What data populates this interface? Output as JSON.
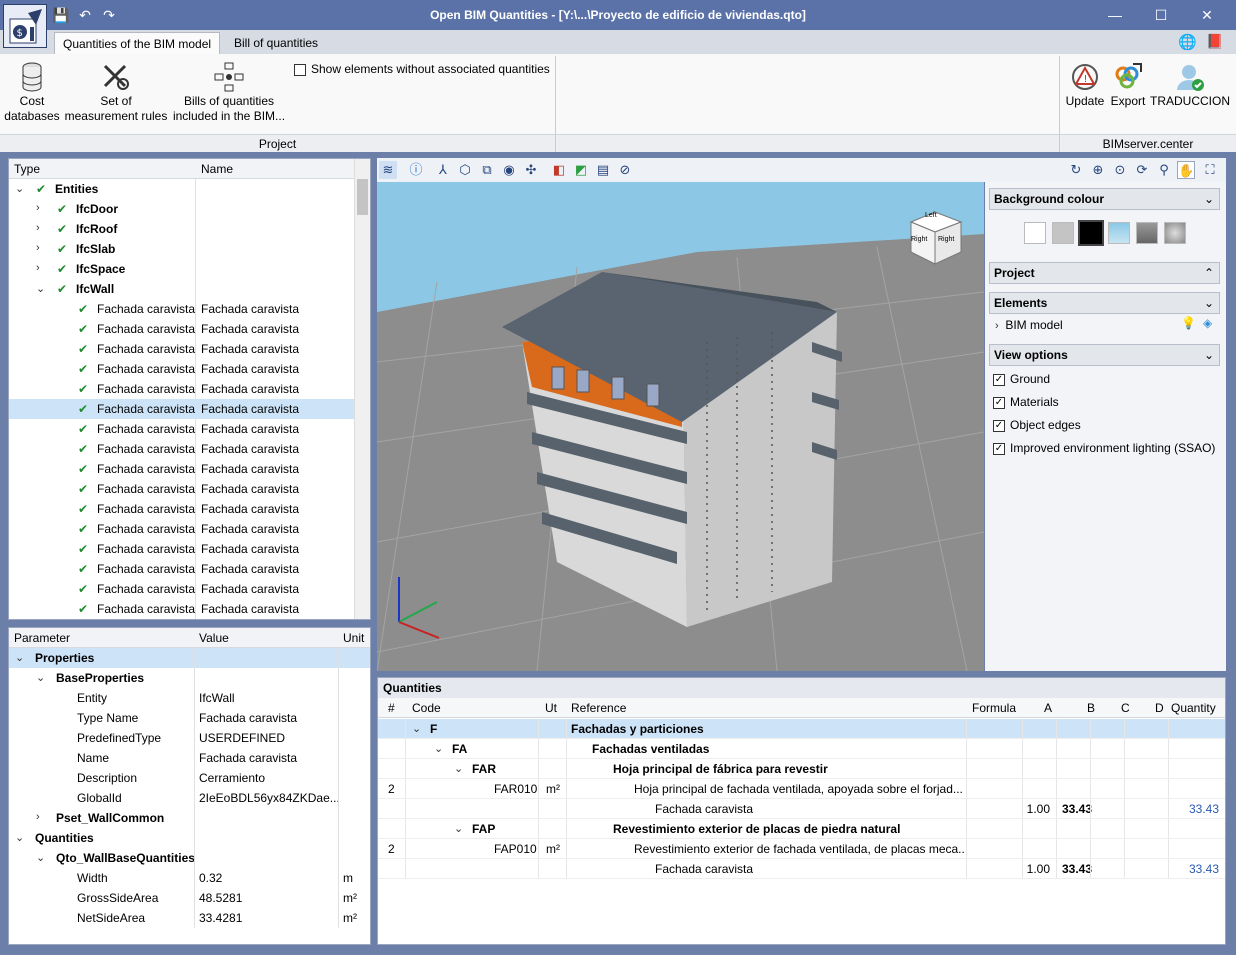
{
  "window": {
    "title": "Open BIM Quantities - [Y:\\...\\Proyecto de edificio de viviendas.qto]",
    "min": "—",
    "max": "☐",
    "close": "✕"
  },
  "tabs": [
    "Quantities of the BIM model",
    "Bill of quantities"
  ],
  "ribbon": {
    "cost_databases": "Cost\ndatabases",
    "measurement_rules": "Set of\nmeasurement rules",
    "bills_included": "Bills of quantities\nincluded in the BIM...",
    "show_elements": "Show elements without associated quantities",
    "group_project": "Project",
    "update": "Update",
    "export": "Export",
    "traduccion": "TRADUCCION",
    "group_bim": "BIMserver.center"
  },
  "tree": {
    "headers": {
      "type": "Type",
      "name": "Name"
    },
    "rows": [
      {
        "t": "Entities",
        "n": "",
        "lvl": 0,
        "exp": "⌄",
        "b": true
      },
      {
        "t": "IfcDoor",
        "n": "",
        "lvl": 1,
        "exp": "›",
        "b": true
      },
      {
        "t": "IfcRoof",
        "n": "",
        "lvl": 1,
        "exp": "›",
        "b": true
      },
      {
        "t": "IfcSlab",
        "n": "",
        "lvl": 1,
        "exp": "›",
        "b": true
      },
      {
        "t": "IfcSpace",
        "n": "",
        "lvl": 1,
        "exp": "›",
        "b": true
      },
      {
        "t": "IfcWall",
        "n": "",
        "lvl": 1,
        "exp": "⌄",
        "b": true
      },
      {
        "t": "Fachada caravista",
        "n": "Fachada caravista",
        "lvl": 2
      },
      {
        "t": "Fachada caravista",
        "n": "Fachada caravista",
        "lvl": 2
      },
      {
        "t": "Fachada caravista",
        "n": "Fachada caravista",
        "lvl": 2
      },
      {
        "t": "Fachada caravista",
        "n": "Fachada caravista",
        "lvl": 2
      },
      {
        "t": "Fachada caravista",
        "n": "Fachada caravista",
        "lvl": 2
      },
      {
        "t": "Fachada caravista",
        "n": "Fachada caravista",
        "lvl": 2,
        "sel": true
      },
      {
        "t": "Fachada caravista",
        "n": "Fachada caravista",
        "lvl": 2
      },
      {
        "t": "Fachada caravista",
        "n": "Fachada caravista",
        "lvl": 2
      },
      {
        "t": "Fachada caravista",
        "n": "Fachada caravista",
        "lvl": 2
      },
      {
        "t": "Fachada caravista",
        "n": "Fachada caravista",
        "lvl": 2
      },
      {
        "t": "Fachada caravista",
        "n": "Fachada caravista",
        "lvl": 2
      },
      {
        "t": "Fachada caravista",
        "n": "Fachada caravista",
        "lvl": 2
      },
      {
        "t": "Fachada caravista",
        "n": "Fachada caravista",
        "lvl": 2
      },
      {
        "t": "Fachada caravista",
        "n": "Fachada caravista",
        "lvl": 2
      },
      {
        "t": "Fachada caravista",
        "n": "Fachada caravista",
        "lvl": 2
      },
      {
        "t": "Fachada caravista",
        "n": "Fachada caravista",
        "lvl": 2
      }
    ]
  },
  "params": {
    "headers": {
      "param": "Parameter",
      "value": "Value",
      "unit": "Unit"
    },
    "rows": [
      {
        "p": "Properties",
        "v": "",
        "u": "",
        "lvl": 0,
        "exp": "⌄",
        "b": true,
        "sel": true
      },
      {
        "p": "BaseProperties",
        "v": "",
        "u": "",
        "lvl": 1,
        "exp": "⌄",
        "b": true
      },
      {
        "p": "Entity",
        "v": "IfcWall",
        "u": "",
        "lvl": 2
      },
      {
        "p": "Type Name",
        "v": "Fachada caravista",
        "u": "",
        "lvl": 2
      },
      {
        "p": "PredefinedType",
        "v": "USERDEFINED",
        "u": "",
        "lvl": 2
      },
      {
        "p": "Name",
        "v": "Fachada caravista",
        "u": "",
        "lvl": 2
      },
      {
        "p": "Description",
        "v": "Cerramiento",
        "u": "",
        "lvl": 2
      },
      {
        "p": "GlobalId",
        "v": "2IeEoBDL56yx84ZKDae...",
        "u": "",
        "lvl": 2
      },
      {
        "p": "Pset_WallCommon",
        "v": "",
        "u": "",
        "lvl": 1,
        "exp": "›",
        "b": true
      },
      {
        "p": "Quantities",
        "v": "",
        "u": "",
        "lvl": 0,
        "exp": "⌄",
        "b": true
      },
      {
        "p": "Qto_WallBaseQuantities",
        "v": "",
        "u": "",
        "lvl": 1,
        "exp": "⌄",
        "b": true
      },
      {
        "p": "Width",
        "v": "0.32",
        "u": "m",
        "lvl": 2
      },
      {
        "p": "GrossSideArea",
        "v": "48.5281",
        "u": "m²",
        "lvl": 2
      },
      {
        "p": "NetSideArea",
        "v": "33.4281",
        "u": "m²",
        "lvl": 2
      }
    ]
  },
  "viewcube": {
    "top": "Left",
    "front": "Right",
    "side": "Right"
  },
  "sidebar": {
    "bg_colour": "Background colour",
    "project": "Project",
    "elements": "Elements",
    "bim_model": "BIM model",
    "view_options": "View options",
    "options": [
      "Ground",
      "Materials",
      "Object edges",
      "Improved environment lighting (SSAO)"
    ]
  },
  "quantities": {
    "title": "Quantities",
    "headers": {
      "num": "#",
      "code": "Code",
      "ut": "Ut",
      "ref": "Reference",
      "formula": "Formula",
      "a": "A",
      "b": "B",
      "c": "C",
      "d": "D",
      "qty": "Quantity"
    },
    "rows": [
      {
        "num": "",
        "code": "F",
        "lvl": 0,
        "exp": "⌄",
        "ut": "",
        "ref": "Fachadas y particiones",
        "refb": true,
        "a": "",
        "b": "",
        "qty": "",
        "sel": true
      },
      {
        "num": "",
        "code": "FA",
        "lvl": 1,
        "exp": "⌄",
        "ut": "",
        "ref": "Fachadas ventiladas",
        "refb": true,
        "a": "",
        "b": "",
        "qty": ""
      },
      {
        "num": "",
        "code": "FAR",
        "lvl": 2,
        "exp": "⌄",
        "ut": "",
        "ref": "Hoja principal de fábrica para revestir",
        "refb": true,
        "a": "",
        "b": "",
        "qty": ""
      },
      {
        "num": "2",
        "code": "FAR010",
        "lvl": 3,
        "exp": "",
        "ut": "m²",
        "ref": "Hoja principal de fachada ventilada, apoyada sobre el forjad...",
        "refb": false,
        "a": "",
        "b": "",
        "qty": ""
      },
      {
        "num": "",
        "code": "",
        "lvl": 4,
        "exp": "",
        "ut": "",
        "ref": "Fachada caravista",
        "refb": false,
        "a": "1.00",
        "b": "33.43",
        "qty": "33.43"
      },
      {
        "num": "",
        "code": "FAP",
        "lvl": 2,
        "exp": "⌄",
        "ut": "",
        "ref": "Revestimiento exterior de placas de piedra natural",
        "refb": true,
        "a": "",
        "b": "",
        "qty": ""
      },
      {
        "num": "2",
        "code": "FAP010",
        "lvl": 3,
        "exp": "",
        "ut": "m²",
        "ref": "Revestimiento exterior de fachada ventilada, de placas meca...",
        "refb": false,
        "a": "",
        "b": "",
        "qty": ""
      },
      {
        "num": "",
        "code": "",
        "lvl": 4,
        "exp": "",
        "ut": "",
        "ref": "Fachada caravista",
        "refb": false,
        "a": "1.00",
        "b": "33.43",
        "qty": "33.43"
      }
    ]
  },
  "colors": {
    "accent": "#5b72a8",
    "selected": "#cde3f7",
    "orange_facade": "#d96a1c",
    "roof": "#596470",
    "sky": "#8cc8e6",
    "ground": "#8d8d8d"
  }
}
